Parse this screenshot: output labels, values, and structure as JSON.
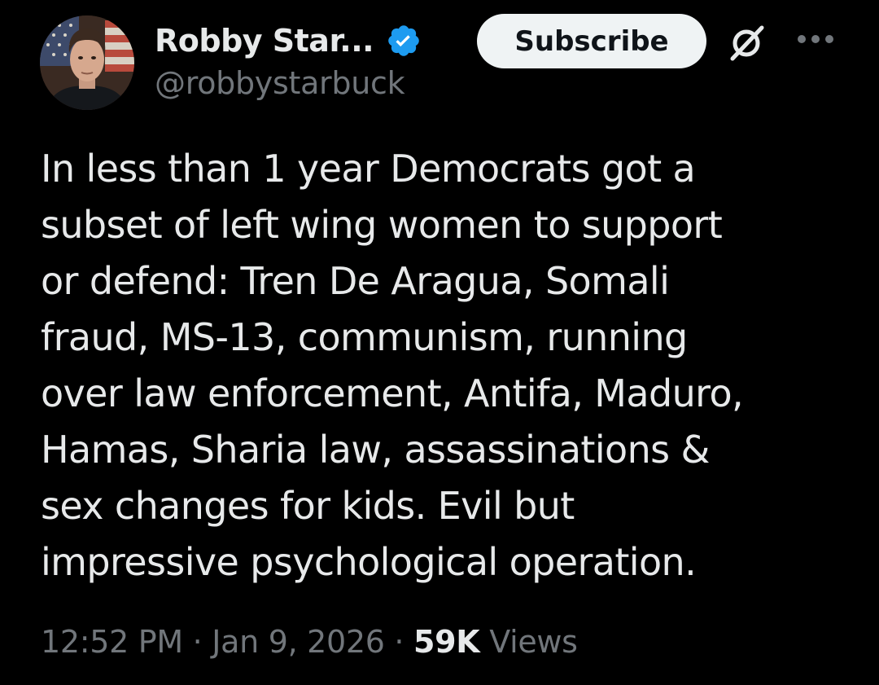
{
  "colors": {
    "background": "#000000",
    "primary_text": "#e7e9ea",
    "secondary_text": "#71767b",
    "verified_badge": "#1d9bf0",
    "subscribe_bg": "#eff3f4",
    "subscribe_text": "#0f1419"
  },
  "author": {
    "display_name": "Robby Star...",
    "handle": "@robbystarbuck",
    "avatar_icon": "profile-photo-with-flag-background",
    "verified_icon": "verified-badge-icon"
  },
  "header": {
    "subscribe_label": "Subscribe",
    "grok_icon": "grok-slash-icon",
    "more_icon": "more-dots-icon"
  },
  "tweet": {
    "lines": [
      "In less than 1 year Democrats got a",
      "subset of left wing women to support",
      "or defend: Tren De Aragua, Somali",
      "fraud, MS-13, communism, running",
      "over law enforcement, Antifa, Maduro,",
      "Hamas, Sharia law, assassinations &",
      "sex changes for kids. Evil but",
      "impressive psychological operation."
    ]
  },
  "meta": {
    "time": "12:52 PM",
    "separator": "·",
    "date": "Jan 9, 2026",
    "views_count": "59K",
    "views_label": "Views"
  }
}
